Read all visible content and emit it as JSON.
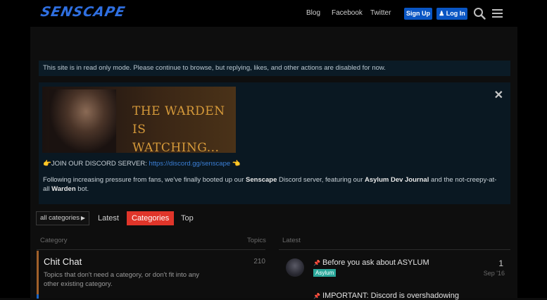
{
  "header": {
    "logo_text": "SENSCAPE",
    "nav": [
      "Blog",
      "Facebook",
      "Twitter"
    ],
    "signup_label": "Sign Up",
    "login_label": "Log In",
    "icons": [
      "search-icon",
      "hamburger-menu-icon"
    ]
  },
  "notice": {
    "readonly": "This site is in read only mode. Please continue to browse, but replying, likes, and other actions are disabled for now."
  },
  "banner": {
    "image_title": "THE WARDEN IS WATCHING...",
    "discord_prefix": "JOIN OUR DISCORD SERVER:",
    "discord_url": "https://discord.gg/senscape",
    "para_1": "Following increasing pressure from fans, we've finally booted up our ",
    "para_b1": "Senscape",
    "para_2": " Discord server, featuring our ",
    "para_b2": "Asylum Dev Journal",
    "para_3": " and the not-creepy-at-all ",
    "para_b3": "Warden",
    "para_4": " bot.",
    "close": "✕"
  },
  "filters": {
    "dropdown_label": "all categories",
    "tabs": [
      "Latest",
      "Categories",
      "Top"
    ],
    "active_tab": "Categories"
  },
  "categories_table": {
    "col_category": "Category",
    "col_topics": "Topics",
    "col_latest": "Latest",
    "rows": [
      {
        "name": "Chit Chat",
        "description": "Topics that don't need a category, or don't fit into any other existing category.",
        "topics": "210"
      }
    ]
  },
  "latest": [
    {
      "title": "Before you ask about ASYLUM",
      "tag": "Asylum",
      "count": "1",
      "date": "Sep '16"
    },
    {
      "title": "IMPORTANT: Discord is overshadowing"
    }
  ],
  "colors": {
    "accent_blue": "#0a56c4",
    "active_tab": "#e0352a",
    "tag_teal": "#2aa79a",
    "category_bar": "#a0602a"
  }
}
